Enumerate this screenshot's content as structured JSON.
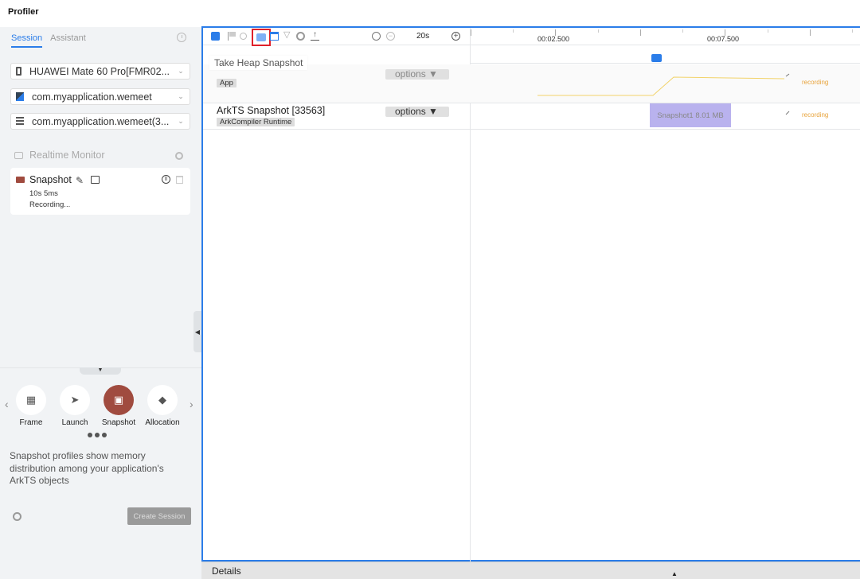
{
  "app": {
    "title": "Profiler"
  },
  "left_panel": {
    "tabs": [
      {
        "label": "Session",
        "active": true
      },
      {
        "label": "Assistant",
        "active": false
      }
    ],
    "device_select": {
      "value": "HUAWEI Mate 60 Pro[FMR02...",
      "icon": "phone-icon"
    },
    "app_select": {
      "value": "com.myapplication.wemeet",
      "icon": "app-icon"
    },
    "process_select": {
      "value": "com.myapplication.wemeet(3...",
      "icon": "process-icon"
    },
    "realtime_monitor": {
      "label": "Realtime Monitor"
    },
    "session_card": {
      "name": "Snapshot",
      "duration": "10s 5ms",
      "status": "Recording..."
    },
    "session_types": [
      {
        "label": "Frame",
        "icon": "frame-icon",
        "active": false
      },
      {
        "label": "Launch",
        "icon": "rocket-icon",
        "active": false
      },
      {
        "label": "Snapshot",
        "icon": "camera-icon",
        "active": true
      },
      {
        "label": "Allocation",
        "icon": "cube-icon",
        "active": false
      }
    ],
    "description": "Snapshot profiles show memory distribution among your application's ArkTS objects",
    "create_button": "Create Session"
  },
  "toolbar": {
    "tooltip": "Take Heap Snapshot",
    "duration": "20s"
  },
  "timeline": {
    "ticks": [
      "00:02.500",
      "00:07.500"
    ]
  },
  "tracks": [
    {
      "title": "",
      "tag": "App",
      "options_label": "options",
      "status": "recording"
    },
    {
      "title": "ArkTS Snapshot [33563]",
      "tag": "ArkCompiler Runtime",
      "options_label": "options",
      "status": "recording",
      "snapshot": {
        "name": "Snapshot1",
        "size": "8.01 MB"
      }
    }
  ],
  "details": {
    "label": "Details"
  },
  "colors": {
    "accent": "#2b7de9",
    "snapshot_active": "#a04b3f",
    "recording": "#e8a33b",
    "snapshot_block": "#b9b2ee",
    "highlight_box": "#e0202a"
  }
}
